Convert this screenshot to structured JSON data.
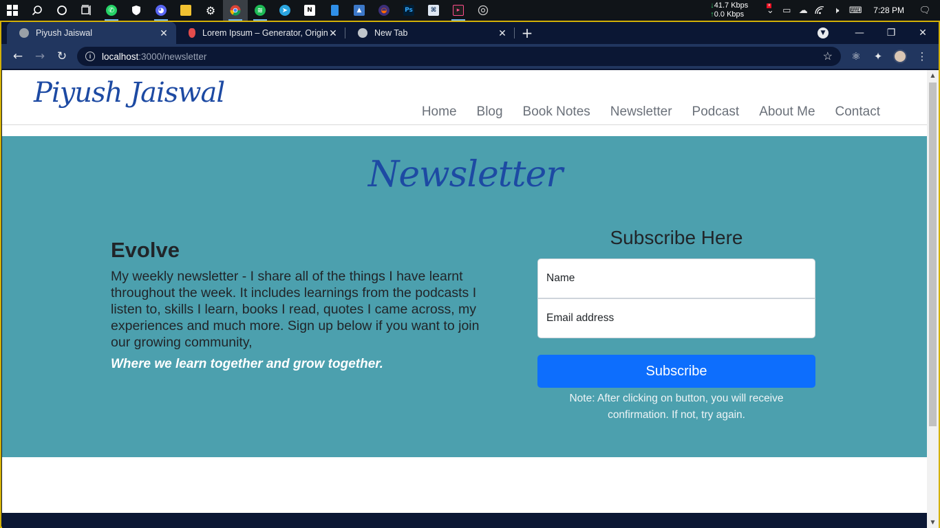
{
  "taskbar": {
    "apps": [
      {
        "name": "windows-start-icon"
      },
      {
        "name": "search-icon"
      },
      {
        "name": "cortana-icon"
      },
      {
        "name": "task-view-icon"
      },
      {
        "name": "whatsapp-icon"
      },
      {
        "name": "security-icon"
      },
      {
        "name": "discord-icon"
      },
      {
        "name": "file-explorer-icon"
      },
      {
        "name": "settings-icon"
      },
      {
        "name": "chrome-icon"
      },
      {
        "name": "spotify-icon"
      },
      {
        "name": "telegram-icon"
      },
      {
        "name": "notion-icon"
      },
      {
        "name": "files-icon"
      },
      {
        "name": "photos-icon"
      },
      {
        "name": "app-icon"
      },
      {
        "name": "photoshop-icon"
      },
      {
        "name": "editor-icon"
      },
      {
        "name": "terminal-icon"
      },
      {
        "name": "aperture-icon"
      }
    ],
    "photoshop_label": "Ps",
    "net_down": "41.7 Kbps",
    "net_up": "0.0 Kbps",
    "time": "7:28 PM"
  },
  "browser": {
    "tabs": [
      {
        "title": "Piyush Jaiswal",
        "active": true
      },
      {
        "title": "Lorem Ipsum – Generator, Origins",
        "active": false
      },
      {
        "title": "New Tab",
        "active": false
      }
    ],
    "url_host": "localhost",
    "url_path": ":3000/newsletter"
  },
  "site": {
    "logo": "Piyush Jaiswal",
    "nav": [
      "Home",
      "Blog",
      "Book Notes",
      "Newsletter",
      "Podcast",
      "About Me",
      "Contact"
    ]
  },
  "newsletter": {
    "title": "Newsletter",
    "heading": "Evolve",
    "description": "My weekly newsletter - I share all of the things I have learnt throughout the week. It includes learnings from the podcasts I listen to, skills I learn, books I read, quotes I came across, my experiences and much more. Sign up below if you want to join our growing community,",
    "tagline": "Where we learn together and grow together.",
    "form": {
      "heading": "Subscribe Here",
      "name_placeholder": "Name",
      "email_placeholder": "Email address",
      "button": "Subscribe",
      "note": "Note: After clicking on button, you will receive confirmation. If not, try again."
    }
  },
  "colors": {
    "hero_bg": "#4ca0ae",
    "brand_blue": "#1d4aa3",
    "button_blue": "#0d6efd"
  }
}
